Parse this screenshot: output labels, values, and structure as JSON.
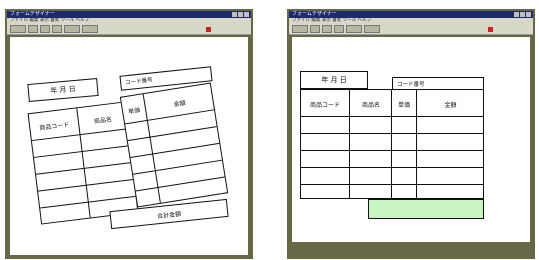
{
  "windows": [
    {
      "title": "フォームデザイナー",
      "menu": "ファイル 編集 表示 書式 ツール ヘルプ",
      "form": {
        "date_label": "年 月 日",
        "code_header": "コード番号",
        "col_code": "商品コード",
        "col_name": "商品名",
        "col_unit": "単価",
        "col_amount": "金額",
        "total_label": "合計金額"
      }
    },
    {
      "title": "フォームデザイナー",
      "menu": "ファイル 編集 表示 書式 ツール ヘルプ",
      "form": {
        "date_label": "年 月 日",
        "code_header": "コード番号",
        "col_code": "商品コード",
        "col_name": "商品名",
        "col_unit": "単価",
        "col_amount": "金額",
        "total_label": ""
      }
    }
  ]
}
